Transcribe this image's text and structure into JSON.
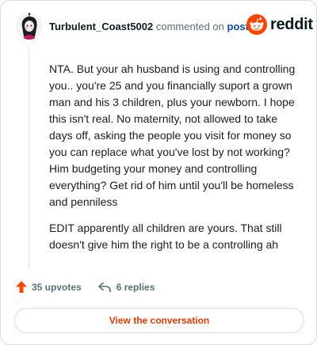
{
  "header": {
    "username": "Turbulent_Coast5002",
    "commented_text": "commented on",
    "post_link": "post",
    "brand": "reddit"
  },
  "comment": {
    "paragraphs": [
      "NTA. But your ah husband is using and controlling you.. you're 25 and you financially suport a grown man and his 3 children, plus your newborn. I hope this isn't real. No maternity, not allowed to take days off, asking the people you visit for money so you can replace what you've lost by not working? Him budgeting your money and controlling everything? Get rid of him until you'll be homeless and penniless",
      "EDIT apparently all children are yours. That still doesn't give him the right to be a controlling ah"
    ]
  },
  "actions": {
    "upvotes": "35 upvotes",
    "replies": "6 replies"
  },
  "cta": {
    "label": "View the conversation"
  },
  "colors": {
    "brand_orange": "#ff4500",
    "cta_text": "#d93a00",
    "link_blue": "#0a4a9b"
  },
  "icons": {
    "upvote": "upvote-arrow-icon",
    "reply": "reply-arrow-icon",
    "logo": "reddit-snoo-icon"
  }
}
